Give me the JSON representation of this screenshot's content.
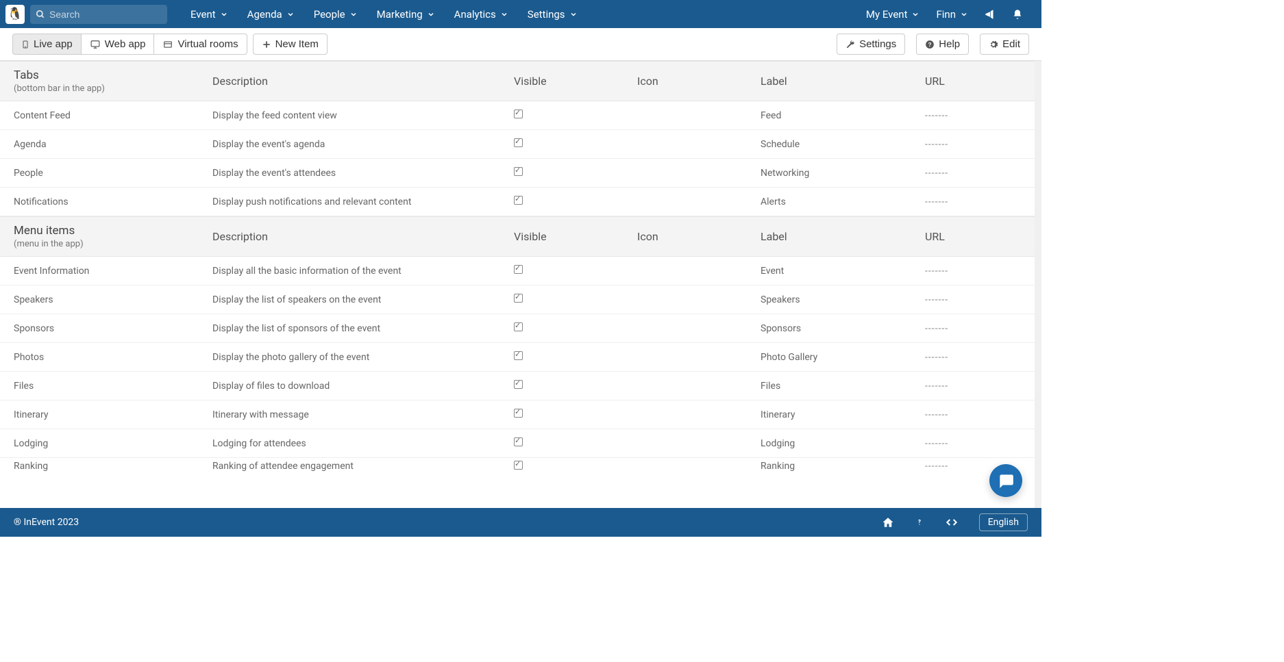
{
  "search": {
    "placeholder": "Search"
  },
  "nav": {
    "items": [
      "Event",
      "Agenda",
      "People",
      "Marketing",
      "Analytics",
      "Settings"
    ],
    "right": {
      "event": "My Event",
      "user": "Finn"
    }
  },
  "subnav": {
    "tabs": [
      "Live app",
      "Web app",
      "Virtual rooms"
    ],
    "new_item": "New Item",
    "right": {
      "settings": "Settings",
      "help": "Help",
      "edit": "Edit"
    }
  },
  "columns": {
    "description": "Description",
    "visible": "Visible",
    "icon": "Icon",
    "label": "Label",
    "url": "URL"
  },
  "sections": [
    {
      "title": "Tabs",
      "subtitle": "(bottom bar in the app)",
      "rows": [
        {
          "name": "Content Feed",
          "desc": "Display the feed content view",
          "visible": true,
          "label": "Feed",
          "url": "-------"
        },
        {
          "name": "Agenda",
          "desc": "Display the event's agenda",
          "visible": true,
          "label": "Schedule",
          "url": "-------"
        },
        {
          "name": "People",
          "desc": "Display the event's attendees",
          "visible": true,
          "label": "Networking",
          "url": "-------"
        },
        {
          "name": "Notifications",
          "desc": "Display push notifications and relevant content",
          "visible": true,
          "label": "Alerts",
          "url": "-------"
        }
      ]
    },
    {
      "title": "Menu items",
      "subtitle": "(menu in the app)",
      "rows": [
        {
          "name": "Event Information",
          "desc": "Display all the basic information of the event",
          "visible": true,
          "label": "Event",
          "url": "-------"
        },
        {
          "name": "Speakers",
          "desc": "Display the list of speakers on the event",
          "visible": true,
          "label": "Speakers",
          "url": "-------"
        },
        {
          "name": "Sponsors",
          "desc": "Display the list of sponsors of the event",
          "visible": true,
          "label": "Sponsors",
          "url": "-------"
        },
        {
          "name": "Photos",
          "desc": "Display the photo gallery of the event",
          "visible": true,
          "label": "Photo Gallery",
          "url": "-------"
        },
        {
          "name": "Files",
          "desc": "Display of files to download",
          "visible": true,
          "label": "Files",
          "url": "-------"
        },
        {
          "name": "Itinerary",
          "desc": "Itinerary with message",
          "visible": true,
          "label": "Itinerary",
          "url": "-------"
        },
        {
          "name": "Lodging",
          "desc": "Lodging for attendees",
          "visible": true,
          "label": "Lodging",
          "url": "-------"
        },
        {
          "name": "Ranking",
          "desc": "Ranking of attendee engagement",
          "visible": true,
          "label": "Ranking",
          "url": "-------"
        }
      ]
    }
  ],
  "footer": {
    "copyright": "® InEvent 2023",
    "language": "English"
  }
}
